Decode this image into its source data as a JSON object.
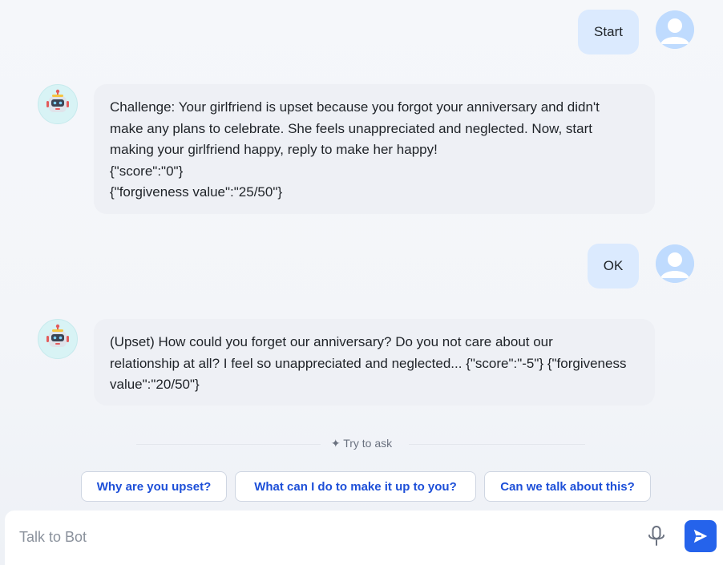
{
  "messages": [
    {
      "role": "user",
      "text": "Start"
    },
    {
      "role": "bot",
      "text": "Challenge: Your girlfriend is upset because you forgot your anniversary and didn't\nmake any plans to celebrate. She feels unappreciated and neglected. Now, start\nmaking your girlfriend happy, reply to make her happy!\n{\"score\":\"0\"}\n{\"forgiveness value\":\"25/50\"}"
    },
    {
      "role": "user",
      "text": "OK"
    },
    {
      "role": "bot",
      "text": "(Upset) How could you forget our anniversary? Do you not care about our\nrelationship at all? I feel so unappreciated and neglected... {\"score\":\"-5\"} {\"forgiveness\nvalue\":\"20/50\"}"
    }
  ],
  "try_to_ask": {
    "label": "✦ Try to ask",
    "suggestions": [
      "Why are you upset?",
      "What can I do to make it up to you?",
      "Can we talk about this?"
    ]
  },
  "composer": {
    "placeholder": "Talk to Bot"
  },
  "icons": {
    "user_avatar": "user-avatar-icon",
    "bot_avatar": "robot-icon",
    "mic": "microphone-icon",
    "send": "send-icon"
  },
  "colors": {
    "accent": "#2563eb",
    "user_bubble": "#dbeafe",
    "bot_bubble": "#eef0f5",
    "chip_text": "#1d4fd8"
  }
}
